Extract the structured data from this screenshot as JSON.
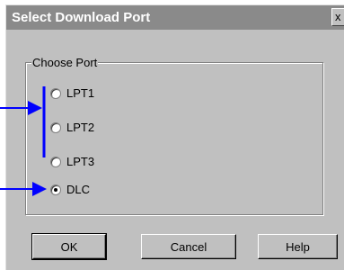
{
  "dialog": {
    "title": "Select Download Port",
    "close_glyph": "x"
  },
  "group": {
    "label": "Choose Port",
    "options": [
      {
        "label": "LPT1",
        "selected": false
      },
      {
        "label": "LPT2",
        "selected": false
      },
      {
        "label": "LPT3",
        "selected": false
      },
      {
        "label": "DLC",
        "selected": true
      }
    ]
  },
  "buttons": {
    "ok": "OK",
    "cancel": "Cancel",
    "help": "Help"
  },
  "colors": {
    "annotation": "#0000ff",
    "title_bar": "#8a8a8a",
    "face": "#c0c0c0"
  }
}
